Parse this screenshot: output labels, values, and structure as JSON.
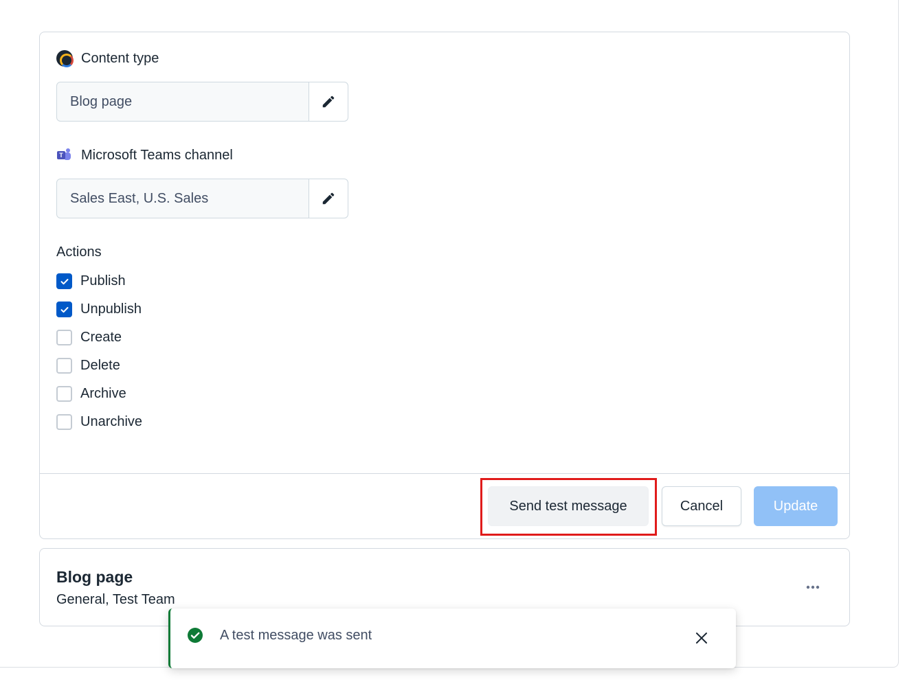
{
  "content_type": {
    "label": "Content type",
    "icon": "contentful-logo-icon",
    "value": "Blog page"
  },
  "teams_channel": {
    "label": "Microsoft Teams channel",
    "icon": "microsoft-teams-icon",
    "value": "Sales East, U.S. Sales"
  },
  "actions": {
    "heading": "Actions",
    "items": [
      {
        "label": "Publish",
        "checked": true
      },
      {
        "label": "Unpublish",
        "checked": true
      },
      {
        "label": "Create",
        "checked": false
      },
      {
        "label": "Delete",
        "checked": false
      },
      {
        "label": "Archive",
        "checked": false
      },
      {
        "label": "Unarchive",
        "checked": false
      }
    ]
  },
  "footer": {
    "send_test_label": "Send test message",
    "cancel_label": "Cancel",
    "update_label": "Update"
  },
  "summary": {
    "title": "Blog page",
    "subtitle": "General, Test Team"
  },
  "toast": {
    "message": "A test message was sent"
  },
  "colors": {
    "primary": "#0059c8",
    "update_disabled": "#91c1f7",
    "highlight": "#e01b1b",
    "success": "#0e7a36"
  }
}
